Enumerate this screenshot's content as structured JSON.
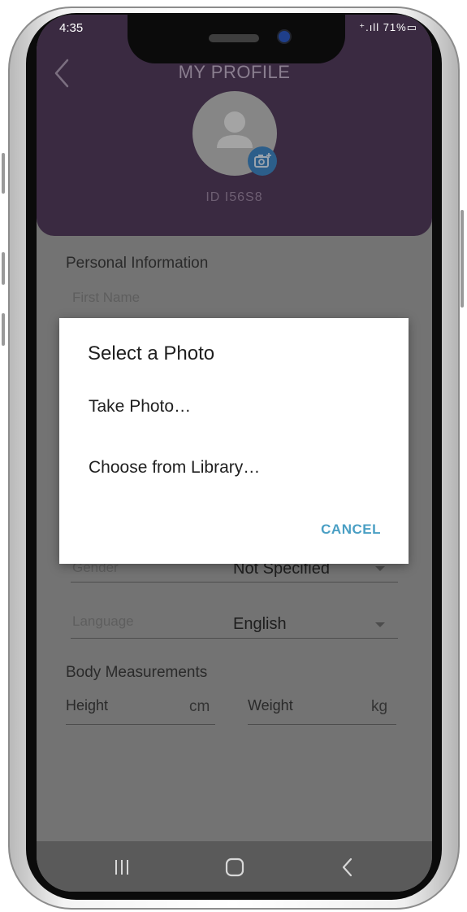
{
  "status_bar": {
    "time": "4:35",
    "indicators": "⁺.ıll 71%▭"
  },
  "header": {
    "title": "MY PROFILE",
    "user_id": "ID I56S8",
    "back_icon": "chevron-left-icon",
    "avatar_icon": "person-icon",
    "camera_icon": "camera-add-icon"
  },
  "personal": {
    "section_title": "Personal Information",
    "first_name_label": "First Name",
    "gender_label": "Gender",
    "gender_value": "Not Specified",
    "language_label": "Language",
    "language_value": "English"
  },
  "body": {
    "section_title": "Body Measurements",
    "height_label": "Height",
    "height_unit": "cm",
    "weight_label": "Weight",
    "weight_unit": "kg"
  },
  "dialog": {
    "title": "Select a Photo",
    "options": [
      "Take Photo…",
      "Choose from Library…"
    ],
    "cancel": "CANCEL"
  },
  "navbar": {
    "recent": "recent-apps-icon",
    "home": "home-icon",
    "back": "back-icon"
  },
  "colors": {
    "header_bg": "#3a2a41",
    "overlay_bg": "#737373",
    "cancel_accent": "#4a9fc4",
    "camera_badge": "#2c5e8a"
  }
}
